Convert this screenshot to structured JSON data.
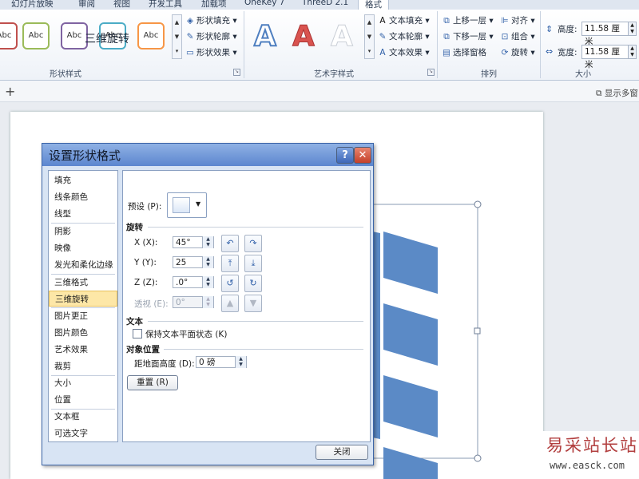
{
  "ribbon": {
    "tabs": [
      "幻灯片放映",
      "审阅",
      "视图",
      "开发工具",
      "加载项",
      "OneKey 7",
      "ThreeD 2.1",
      "格式"
    ],
    "shape_styles": {
      "abc_label": "Abc",
      "fill": "形状填充",
      "outline": "形状轮廓",
      "effects": "形状效果",
      "group_title": "形状样式",
      "border_colors": [
        "#c0504d",
        "#9bbb59",
        "#8064a2",
        "#4bacc6",
        "#f79646"
      ]
    },
    "wordart": {
      "letter": "A",
      "text_fill": "文本填充",
      "text_outline": "文本轮廓",
      "text_effects": "文本效果",
      "group_title": "艺术字样式"
    },
    "arrange": {
      "bring_forward": "上移一层",
      "send_backward": "下移一层",
      "selection_pane": "选择窗格",
      "align": "对齐",
      "group": "组合",
      "rotate": "旋转",
      "group_title": "排列"
    },
    "size": {
      "height_label": "高度:",
      "height_value": "11.58 厘米",
      "width_label": "宽度:",
      "width_value": "11.58 厘米",
      "group_title": "大小"
    }
  },
  "toolbar": {
    "plus": "+",
    "show_more": "显示多窗"
  },
  "dialog": {
    "title": "设置形状格式",
    "help": "?",
    "close_x": "✕",
    "left_items": [
      "填充",
      "线条颜色",
      "线型",
      "阴影",
      "映像",
      "发光和柔化边缘",
      "三维格式",
      "三维旋转",
      "图片更正",
      "图片颜色",
      "艺术效果",
      "裁剪",
      "大小",
      "位置",
      "文本框",
      "可选文字"
    ],
    "selected_index": 7,
    "panel": {
      "title": "三维旋转",
      "preset_label": "预设 (P):",
      "rotation_header": "旋转",
      "x_label": "X (X):",
      "x_value": "45°",
      "y_label": "Y (Y):",
      "y_value": "25",
      "z_label": "Z (Z):",
      "z_value": ".0°",
      "persp_label": "透视 (E):",
      "persp_value": "0°",
      "text_header": "文本",
      "keep_flat": "保持文本平面状态 (K)",
      "object_pos_header": "对象位置",
      "distance_label": "距地面高度 (D):",
      "distance_value": "0 磅",
      "reset": "重置 (R)"
    },
    "close_button": "关闭"
  },
  "watermark": {
    "cn": "易采站长站",
    "url": "www.easck.com"
  },
  "colors": {
    "accent": "#5b8ac6"
  }
}
